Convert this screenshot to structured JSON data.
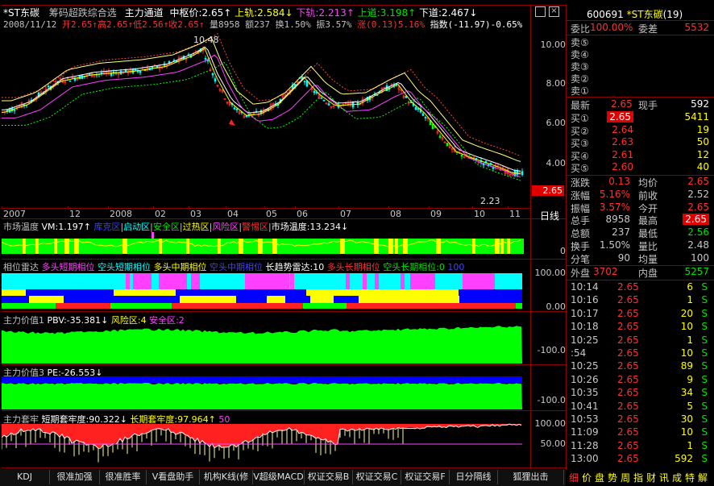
{
  "header": {
    "stock_name": "*ST东碳",
    "indicator_title": "筹码超跌综合选",
    "channel_label": "主力通道",
    "mid_label": "中枢价:2.65",
    "upper_rail": "上轨:2.584",
    "lower_rail": "下轨:2.213",
    "up_line": "上道:3.198",
    "down_line": "下道:2.467",
    "arrow_up": "↑",
    "arrow_down": "↓"
  },
  "quote_line": {
    "date": "2008/11/12",
    "open": "开2.65",
    "high": "高2.65",
    "low": "低2.56",
    "close": "收2.65",
    "volume": "量8958",
    "amount": "额237",
    "turnover": "换1.50%",
    "amplitude": "振3.57%",
    "change": "涨(0.13)5.16%",
    "index": "指数(-11.97)-0.65%"
  },
  "main_chart": {
    "y_ticks": [
      "10.00",
      "8.00",
      "6.00",
      "4.00"
    ],
    "high_label": "10.48",
    "low_label": "2.23",
    "price_marker": "2.65",
    "x_labels": [
      "2007",
      "12",
      "2008",
      "02",
      "03",
      "04",
      "05",
      "06",
      "07",
      "08",
      "09",
      "10",
      "11"
    ],
    "period": "日线"
  },
  "panel_temp": {
    "title": "市场温度",
    "vm": "VM:1.197",
    "z1": "库克区",
    "z2": "启动区",
    "z3": "安全区",
    "z4": "过热区",
    "z5": "风险区",
    "z6": "警惕区",
    "t2": "市场温度:13.234",
    "axis0": "0"
  },
  "panel_radar": {
    "title": "相位雷达",
    "l1": "多头短期相位",
    "l2": "空头短期相位",
    "l3": "多头中期相位",
    "l4": "空头中期相位",
    "l5": "长趋势雷达:10",
    "l6": "多头长期相位",
    "l7": "空头长期相位:0",
    "l8": "100",
    "axis_top": "100.00",
    "axis_bot": "0.00"
  },
  "panel_value1": {
    "title": "主力价值1",
    "pbv": "PBV:-35.381",
    "risk": "风险区:4",
    "safe": "安全区:2",
    "axis": "-100.0"
  },
  "panel_value3": {
    "title": "主力价值3",
    "pe": "PE:-26.553",
    "axis": "-100.0"
  },
  "panel_trap": {
    "title": "主力套牢",
    "short": "短期套牢度:90.322",
    "long": "长期套牢度:97.964",
    "v50": "50",
    "axis_top": "100.00",
    "axis_mid": "50.00"
  },
  "right_panel": {
    "code": "600691",
    "name": "*ST东碳",
    "count": "(19)",
    "weibi_label": "委比",
    "weibi_value": "100.00%",
    "weicha_label": "委差",
    "weicha_value": "5532",
    "sells": [
      {
        "label": "卖⑤",
        "price": "",
        "vol": ""
      },
      {
        "label": "卖④",
        "price": "",
        "vol": ""
      },
      {
        "label": "卖③",
        "price": "",
        "vol": ""
      },
      {
        "label": "卖②",
        "price": "",
        "vol": ""
      },
      {
        "label": "卖①",
        "price": "",
        "vol": ""
      }
    ],
    "latest_label": "最新",
    "latest_value": "2.65",
    "current_label": "现手",
    "current_value": "592",
    "buys": [
      {
        "label": "买①",
        "price": "2.65",
        "vol": "5411"
      },
      {
        "label": "买②",
        "price": "2.64",
        "vol": "19"
      },
      {
        "label": "买③",
        "price": "2.63",
        "vol": "50"
      },
      {
        "label": "买④",
        "price": "2.61",
        "vol": "12"
      },
      {
        "label": "买⑤",
        "price": "2.60",
        "vol": "40"
      }
    ],
    "stats": [
      {
        "l1": "涨跌",
        "v1": "0.13",
        "l2": "均价",
        "v2": "2.65"
      },
      {
        "l1": "涨幅",
        "v1": "5.16%",
        "l2": "前收",
        "v2": "2.52"
      },
      {
        "l1": "振幅",
        "v1": "3.57%",
        "l2": "今开",
        "v2": "2.65"
      },
      {
        "l1": "总手",
        "v1": "8958",
        "l2": "最高",
        "v2": "2.65"
      },
      {
        "l1": "总额",
        "v1": "237",
        "l2": "最低",
        "v2": "2.56"
      },
      {
        "l1": "换手",
        "v1": "1.50%",
        "l2": "量比",
        "v2": "2.48"
      },
      {
        "l1": "分笔",
        "v1": "90",
        "l2": "均量",
        "v2": "100"
      }
    ],
    "outer_label": "外盘",
    "outer_value": "3702",
    "inner_label": "内盘",
    "inner_value": "5257",
    "ticks": [
      {
        "t": "10:14",
        "p": "2.65",
        "v": "6",
        "s": "S"
      },
      {
        "t": "10:16",
        "p": "2.65",
        "v": "1",
        "s": "S"
      },
      {
        "t": "10:17",
        "p": "2.65",
        "v": "20",
        "s": "S"
      },
      {
        "t": "10:18",
        "p": "2.65",
        "v": "10",
        "s": "S"
      },
      {
        "t": "10:25",
        "p": "2.65",
        "v": "1",
        "s": "S"
      },
      {
        "t": ":54",
        "p": "2.65",
        "v": "10",
        "s": "S"
      },
      {
        "t": "10:25",
        "p": "2.65",
        "v": "89",
        "s": "S"
      },
      {
        "t": "10:26",
        "p": "2.65",
        "v": "9",
        "s": "S"
      },
      {
        "t": "10:35",
        "p": "2.65",
        "v": "34",
        "s": "S"
      },
      {
        "t": "10:41",
        "p": "2.65",
        "v": "5",
        "s": "S"
      },
      {
        "t": "10:53",
        "p": "2.65",
        "v": "30",
        "s": "S"
      },
      {
        "t": "11:09",
        "p": "2.65",
        "v": "10",
        "s": "S"
      },
      {
        "t": "11:28",
        "p": "2.65",
        "v": "1",
        "s": "S"
      },
      {
        "t": "13:00",
        "p": "2.65",
        "v": "592",
        "s": "S"
      }
    ],
    "bottom_tabs": [
      "细",
      "价",
      "盘",
      "势",
      "周",
      "指",
      "财",
      "讯",
      "成",
      "特",
      "解"
    ]
  },
  "toolbar_buttons": [
    "KDJ",
    "很准加强",
    "很准胜率",
    "V看盘助手",
    "机构K线(修",
    "V超级MACD",
    "权证交易B",
    "权证交易C",
    "权证交易F",
    "日分隔线",
    "狐狸出击"
  ]
}
